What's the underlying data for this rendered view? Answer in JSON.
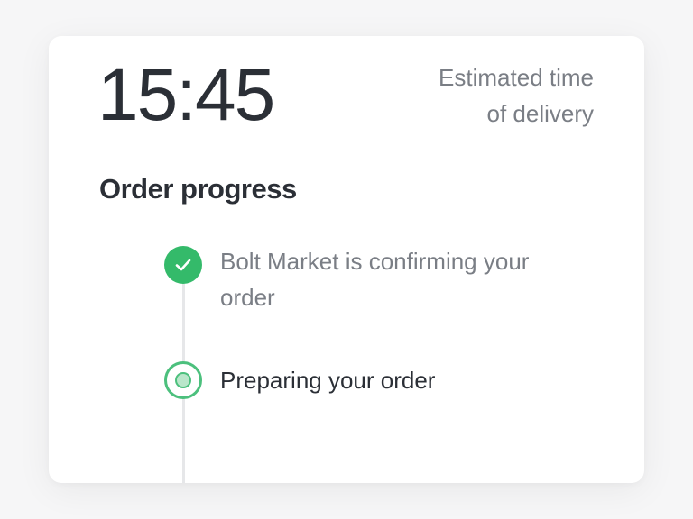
{
  "eta": {
    "time": "15:45",
    "label_line1": "Estimated time",
    "label_line2": "of delivery"
  },
  "progress": {
    "title": "Order progress",
    "steps": [
      {
        "label": "Bolt Market is confirming your order",
        "status": "done",
        "icon": "check-icon"
      },
      {
        "label": "Preparing your order",
        "status": "active",
        "icon": "current-step-icon"
      }
    ]
  },
  "colors": {
    "accent_green": "#34ba6a",
    "text_primary": "#2b2f36",
    "text_secondary": "#7a7e85"
  }
}
